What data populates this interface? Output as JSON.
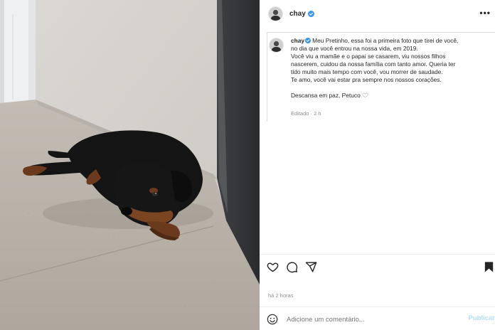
{
  "post": {
    "username": "chay",
    "more_label": "•••",
    "caption": {
      "username": "chay",
      "lines": [
        "Meu Pretinho, essa foi a primeira foto que tirei de você,",
        "no dia que você entrou na nossa vida, em 2019.",
        "Você viu a mamãe e o papai se casarem, viu nossos filhos",
        "nascerem, cuidou da nossa família com tanto amor. Queria ter",
        "tido muito mais tempo com você, vou morrer de saudade.",
        "Te amo, você vai estar pra sempre nos nossos corações."
      ],
      "closing": "Descansa em paz, Petuco",
      "edited": "Editado · 2 h"
    },
    "timestamp": "há 2 horas",
    "comment": {
      "placeholder": "Adicione um comentário...",
      "publish_label": "Publicar"
    },
    "icons": {
      "like": "heart-icon",
      "comment": "comment-icon",
      "share": "share-icon",
      "save": "bookmark-icon",
      "emoji": "emoji-icon",
      "verified": "verified-badge-icon"
    },
    "colors": {
      "verified": "#3897f0",
      "muted": "#8e8e8e",
      "publish": "#b2dffc"
    }
  }
}
